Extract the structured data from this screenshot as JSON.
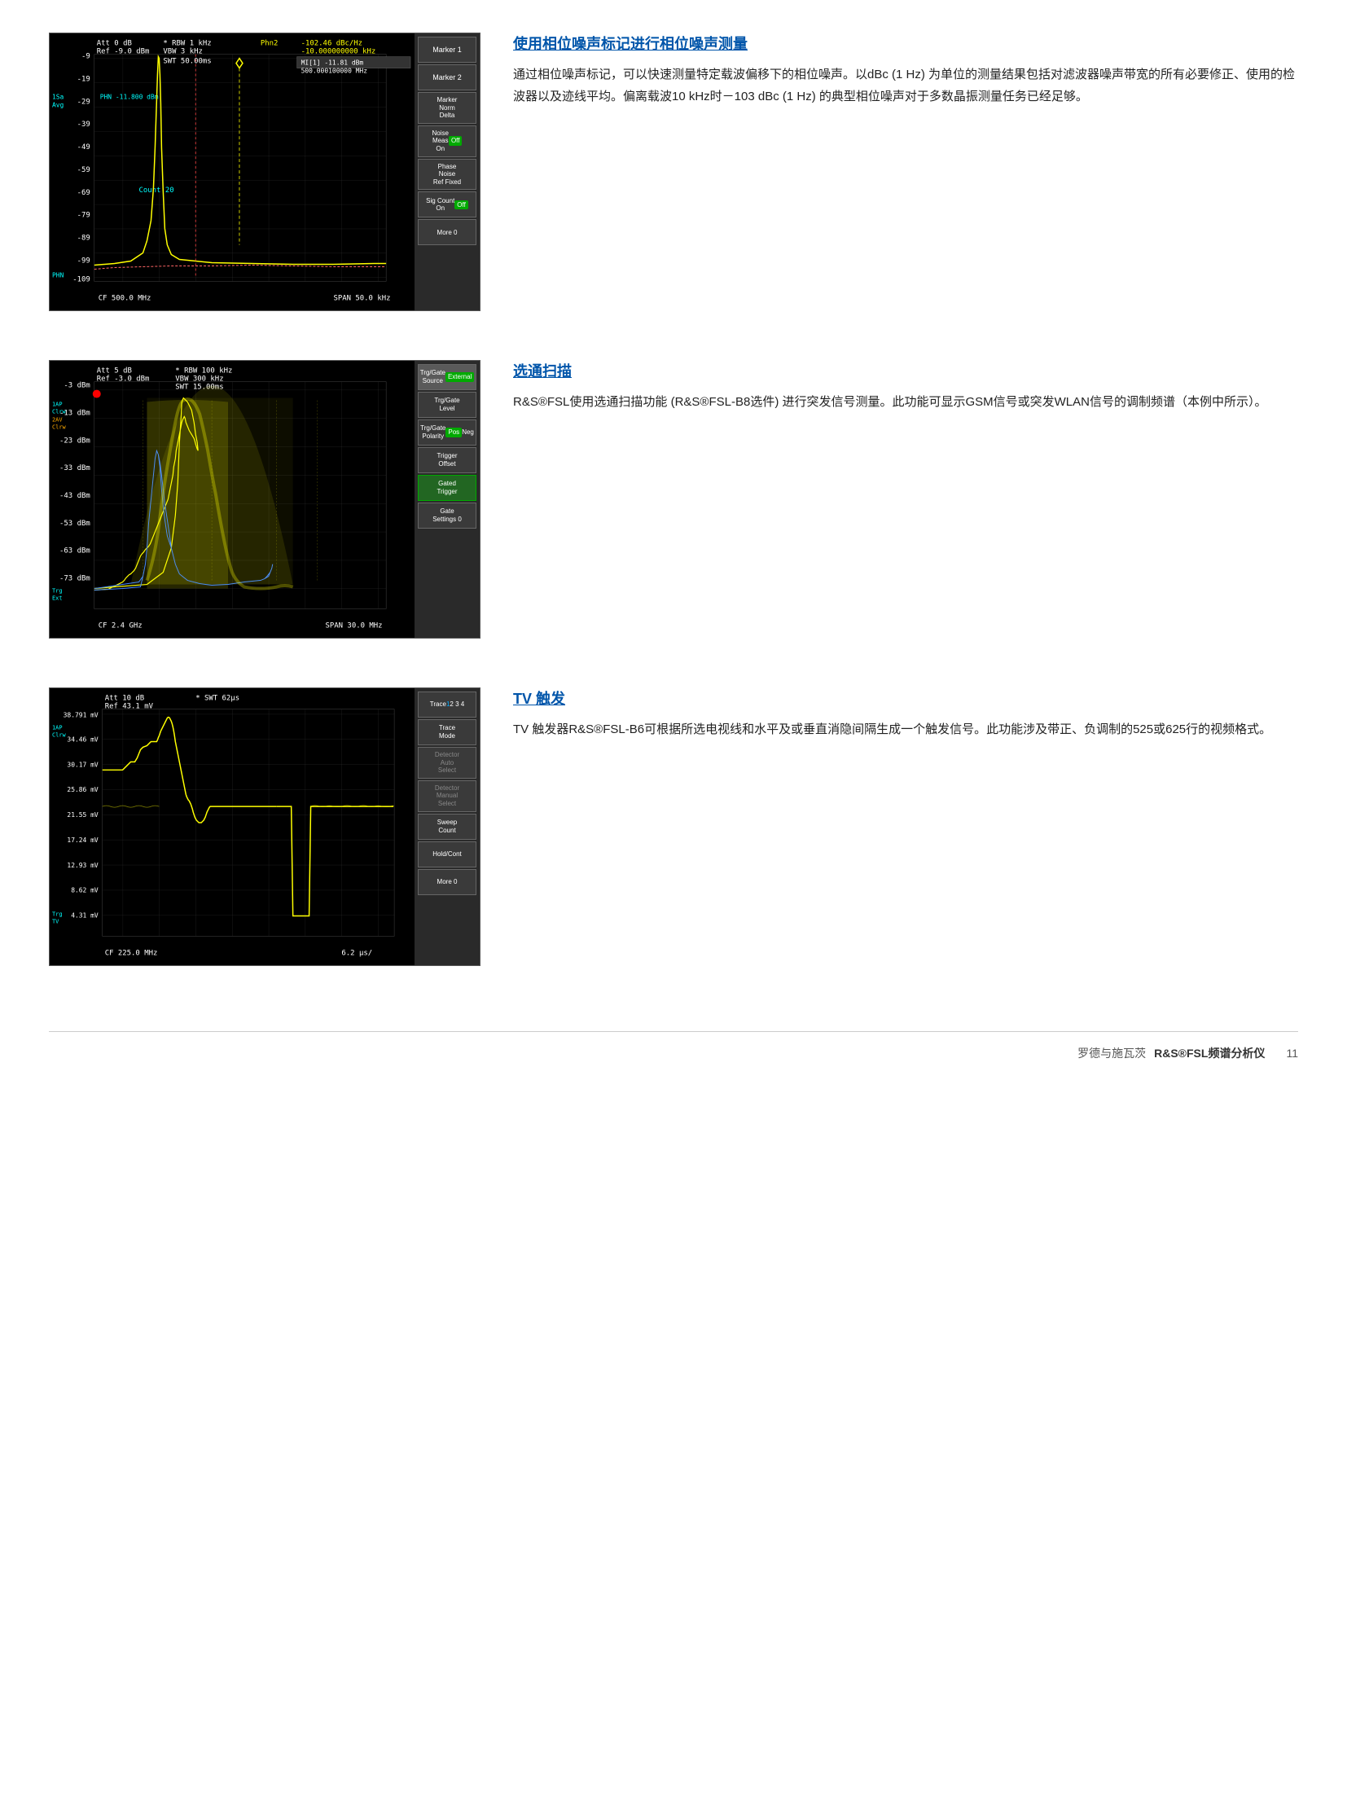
{
  "sections": [
    {
      "id": "phase-noise",
      "title": "使用相位噪声标记进行相位噪声测量",
      "body": "通过相位噪声标记，可以快速测量特定载波偏移下的相位噪声。以dBc (1 Hz) 为单位的测量结果包括对滤波器噪声带宽的所有必要修正、使用的检波器以及迹线平均。偏离载波10 kHz时－103 dBc (1 Hz) 的典型相位噪声对于多数晶振测量任务已经足够。",
      "screen": {
        "att": "Att  0 dB",
        "ref": "Ref -9.0 dBm",
        "rbw": "* RBW  1 kHz",
        "vbw": "VBW  3 kHz",
        "phn2": "Phn2",
        "swt": "SWT 50.00ms",
        "marker_val": "-102.46 dBc/Hz",
        "marker_freq": "-10.000000000 kHz",
        "mi1": "MI[1]",
        "mi1_val": "-11.81 dBm",
        "mi1_freq": "500.000100000 MHz",
        "phn_val": "PHN -11.800 dBm",
        "count": "Count 20",
        "cf": "CF 500.0 MHz",
        "span": "SPAN 50.0 kHz",
        "y_labels": [
          "-9",
          "-19",
          "-29",
          "-39",
          "-49",
          "-59",
          "-69",
          "-79",
          "-89",
          "-99",
          "-109"
        ],
        "left_labels": [
          "1Sa",
          "Avg"
        ],
        "phn_label": "PHN"
      },
      "buttons": [
        {
          "label": "Marker 1",
          "type": "normal"
        },
        {
          "label": "Marker 2",
          "type": "normal"
        },
        {
          "label": "Marker\nNorm\nDelta",
          "type": "normal"
        },
        {
          "label": "Noise\nMeas\nOn  Off",
          "type": "green-off"
        },
        {
          "label": "Phase\nNoise\nRef Fixed",
          "type": "normal"
        },
        {
          "label": "Sig Count\nOn  Off",
          "type": "green-off"
        },
        {
          "label": "More  0",
          "type": "normal"
        }
      ]
    },
    {
      "id": "gate-scan",
      "title": "选通扫描",
      "body": "R&S®FSL使用选通扫描功能 (R&S®FSL-B8选件) 进行突发信号测量。此功能可显示GSM信号或突发WLAN信号的调制频谱（本例中所示）。",
      "screen": {
        "att": "Att  5 dB",
        "ref": "Ref -3.0 dBm",
        "rbw": "* RBW  100 kHz",
        "vbw": "VBW  300 kHz",
        "swt": "SWT 15.00ms",
        "cf": "CF 2.4 GHz",
        "span": "SPAN 30.0 MHz",
        "y_labels": [
          "-3 dBm",
          "-13 dBm",
          "-23 dBm",
          "-33 dBm",
          "-43 dBm",
          "-53 dBm",
          "-63 dBm",
          "-73 dBm"
        ],
        "left_labels": [
          "1AP",
          "Clrw",
          "2AV",
          "Clrw"
        ],
        "trg_label": "Trg\nExt"
      },
      "buttons": [
        {
          "label": "Trg/Gate\nSource\nExternal",
          "type": "highlighted"
        },
        {
          "label": "Trg/Gate\nLevel",
          "type": "normal"
        },
        {
          "label": "Trg/Gate\nPolarity\nPos  Neg",
          "type": "green-pos"
        },
        {
          "label": "Trigger\nOffset",
          "type": "normal"
        },
        {
          "label": "Gated\nTrigger",
          "type": "highlighted"
        },
        {
          "label": "Gate\nSettings  0",
          "type": "normal"
        }
      ]
    },
    {
      "id": "tv-trigger",
      "title": "TV 触发",
      "body": "TV 触发器R&S®FSL-B6可根据所选电视线和水平及或垂直消隐间隔生成一个触发信号。此功能涉及带正、负调制的525或625行的视频格式。",
      "screen": {
        "att": "Att  10 dB",
        "ref": "Ref  43.1 mV",
        "swt": "* SWT 62µs",
        "cf": "CF 225.0 MHz",
        "span": "6.2 µs/",
        "y_labels": [
          "38.791 mV",
          "34.46 mV",
          "30.17 mV",
          "25.86 mV",
          "21.55 mV",
          "17.24 mV",
          "12.93 mV",
          "8.62 mV",
          "4.31 mV"
        ],
        "left_labels": [
          "1AP",
          "Clrw"
        ],
        "trg_label": "Trg\nTV"
      },
      "buttons": [
        {
          "label": "Trace\n1  2  3  4",
          "type": "trace"
        },
        {
          "label": "Trace\nMode",
          "type": "normal"
        },
        {
          "label": "Detector\nAuto\nSelect",
          "type": "dimmed"
        },
        {
          "label": "Detector\nManual\nSelect",
          "type": "dimmed"
        },
        {
          "label": "Sweep\nCount",
          "type": "normal"
        },
        {
          "label": "Hold/Cont",
          "type": "normal"
        },
        {
          "label": "More  0",
          "type": "normal"
        }
      ]
    }
  ],
  "footer": {
    "brand": "罗德与施瓦茨",
    "product": "R&S®FSL频谱分析仪",
    "page": "11"
  }
}
